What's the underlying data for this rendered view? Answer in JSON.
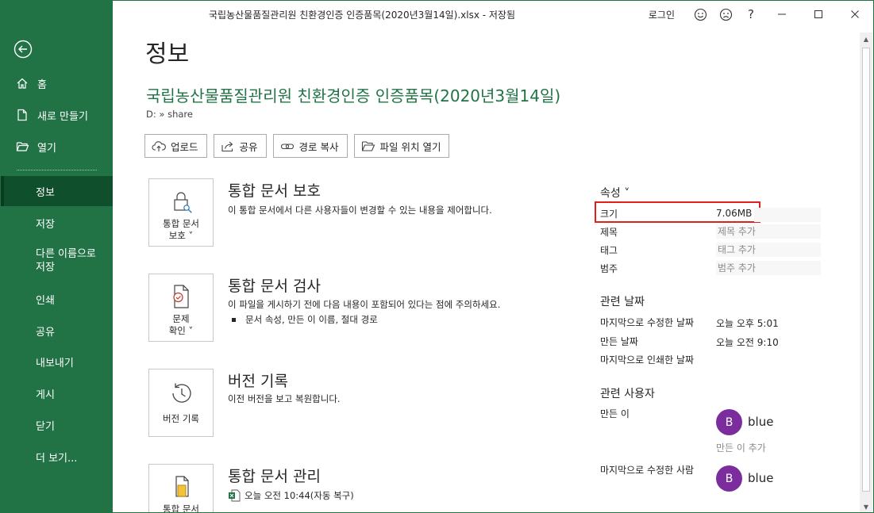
{
  "window": {
    "title": "국립농산물품질관리원 친환경인증 인증품목(2020년3월14일).xlsx  -  저장됨",
    "login": "로그인",
    "help": "?"
  },
  "sidebar": {
    "items": [
      {
        "label": "홈",
        "icon": "home-icon"
      },
      {
        "label": "새로 만들기",
        "icon": "new-document-icon"
      },
      {
        "label": "열기",
        "icon": "folder-open-icon"
      },
      {
        "label": "정보"
      },
      {
        "label": "저장"
      },
      {
        "label": "다른 이름으로"
      },
      {
        "label": "저장"
      },
      {
        "label": "인쇄"
      },
      {
        "label": "공유"
      },
      {
        "label": "내보내기"
      },
      {
        "label": "게시"
      },
      {
        "label": "닫기"
      },
      {
        "label": "더 보기..."
      }
    ]
  },
  "main": {
    "page_title": "정보",
    "doc_title": "국립농산물품질관리원 친환경인증 인증품목(2020년3월14일)",
    "path": "D: » share",
    "actions": {
      "upload": "업로드",
      "share": "공유",
      "copy_path": "경로 복사",
      "open_location": "파일 위치 열기"
    },
    "protect": {
      "card_line1": "통합 문서",
      "card_line2": "보호 ˅",
      "title": "통합 문서 보호",
      "desc": "이 통합 문서에서 다른 사용자들이 변경할 수 있는 내용을 제어합니다."
    },
    "inspect": {
      "card_line1": "문제",
      "card_line2": "확인 ˅",
      "title": "통합 문서 검사",
      "desc": "이 파일을 게시하기 전에 다음 내용이 포함되어 있다는 점에 주의하세요.",
      "bullet": "문서 속성, 만든 이 이름, 절대 경로"
    },
    "versions": {
      "card_label": "버전 기록",
      "title": "버전 기록",
      "desc": "이전 버전을 보고 복원합니다."
    },
    "manage": {
      "card_label": "통합 문서",
      "title": "통합 문서 관리",
      "entry": "오늘 오전 10:44(자동 복구)"
    }
  },
  "properties": {
    "header": "속성 ˅",
    "size_label": "크기",
    "size_value": "7.06MB",
    "title_label": "제목",
    "title_value": "제목 추가",
    "tags_label": "태그",
    "tags_value": "태그 추가",
    "category_label": "범주",
    "category_value": "범주 추가",
    "dates_header": "관련 날짜",
    "modified_label": "마지막으로 수정한 날짜",
    "modified_value": "오늘 오후 5:01",
    "created_label": "만든 날짜",
    "created_value": "오늘 오전 9:10",
    "printed_label": "마지막으로 인쇄한 날짜",
    "people_header": "관련 사용자",
    "author_label": "만든 이",
    "author_initial": "B",
    "author_name": "blue",
    "add_author": "만든 이 추가",
    "last_modified_by_label": "마지막으로 수정한 사람",
    "modifier_initial": "B",
    "modifier_name": "blue"
  },
  "colors": {
    "accent": "#217346",
    "sidebar_active": "#0f4f2b",
    "highlight_box": "#e0201f",
    "avatar": "#7b2d9e"
  }
}
